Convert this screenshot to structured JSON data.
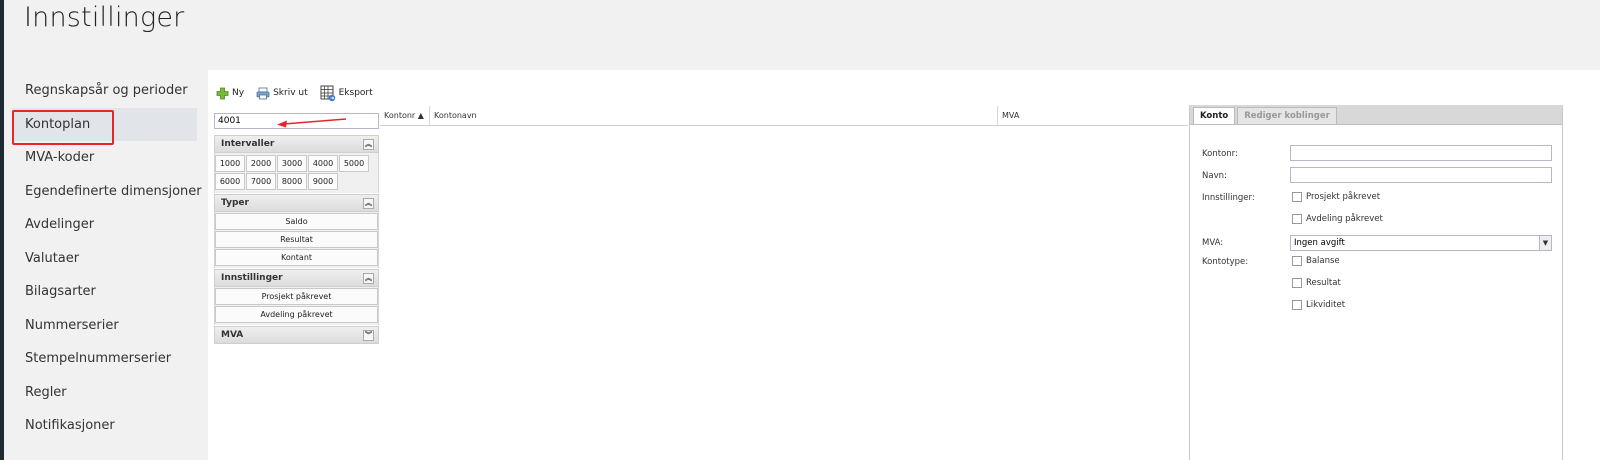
{
  "page": {
    "title": "Innstillinger"
  },
  "sidebar": {
    "items": [
      {
        "label": "Regnskapsår og perioder"
      },
      {
        "label": "Kontoplan"
      },
      {
        "label": "MVA-koder"
      },
      {
        "label": "Egendefinerte dimensjoner"
      },
      {
        "label": "Avdelinger"
      },
      {
        "label": "Valutaer"
      },
      {
        "label": "Bilagsarter"
      },
      {
        "label": "Nummerserier"
      },
      {
        "label": "Stempelnummerserier"
      },
      {
        "label": "Regler"
      },
      {
        "label": "Notifikasjoner"
      }
    ],
    "active_index": 1
  },
  "toolbar": {
    "new_label": "Ny",
    "print_label": "Skriv ut",
    "export_label": "Eksport"
  },
  "filter": {
    "search_value": "4001",
    "intervals": {
      "title": "Intervaller",
      "values": [
        "1000",
        "2000",
        "3000",
        "4000",
        "5000",
        "6000",
        "7000",
        "8000",
        "9000"
      ]
    },
    "types": {
      "title": "Typer",
      "items": [
        "Saldo",
        "Resultat",
        "Kontant"
      ]
    },
    "settings": {
      "title": "Innstillinger",
      "items": [
        "Prosjekt påkrevet",
        "Avdeling påkrevet"
      ]
    },
    "mva": {
      "title": "MVA"
    }
  },
  "grid": {
    "columns": {
      "kontonr": "Kontonr",
      "kontonavn": "Kontonavn",
      "mva": "MVA"
    }
  },
  "detail": {
    "tabs": {
      "konto": "Konto",
      "rediger": "Rediger koblinger"
    },
    "labels": {
      "kontonr": "Kontonr:",
      "navn": "Navn:",
      "innstillinger": "Innstillinger:",
      "mva": "MVA:",
      "kontotype": "Kontotype:"
    },
    "checkboxes": {
      "prosjekt": "Prosjekt påkrevet",
      "avdeling": "Avdeling påkrevet",
      "balanse": "Balanse",
      "resultat": "Resultat",
      "likviditet": "Likviditet"
    },
    "mva_value": "Ingen avgift"
  },
  "colors": {
    "highlight": "#e8252b",
    "active_nav": "#e1e4e9",
    "arrow": "#e8252b"
  }
}
